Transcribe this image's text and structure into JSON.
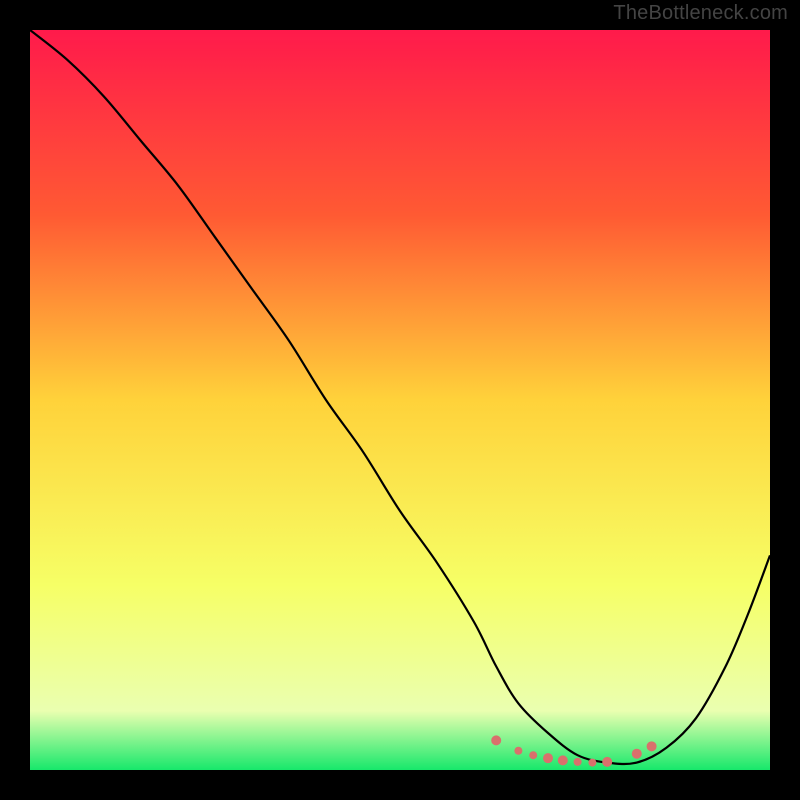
{
  "attribution": "TheBottleneck.com",
  "chart_data": {
    "type": "line",
    "title": "",
    "xlabel": "",
    "ylabel": "",
    "xlim": [
      0,
      100
    ],
    "ylim": [
      0,
      100
    ],
    "gradient_stops": [
      {
        "offset": 0,
        "color": "#ff1a4b"
      },
      {
        "offset": 25,
        "color": "#ff5a33"
      },
      {
        "offset": 50,
        "color": "#ffd23a"
      },
      {
        "offset": 75,
        "color": "#f6ff66"
      },
      {
        "offset": 92,
        "color": "#eaffb0"
      },
      {
        "offset": 100,
        "color": "#17e86b"
      }
    ],
    "series": [
      {
        "name": "bottleneck-curve",
        "x": [
          0,
          5,
          10,
          15,
          20,
          25,
          30,
          35,
          40,
          45,
          50,
          55,
          60,
          63,
          66,
          70,
          74,
          78,
          82,
          86,
          90,
          94,
          97,
          100
        ],
        "y": [
          100,
          96,
          91,
          85,
          79,
          72,
          65,
          58,
          50,
          43,
          35,
          28,
          20,
          14,
          9,
          5,
          2,
          1,
          1,
          3,
          7,
          14,
          21,
          29
        ]
      }
    ],
    "markers": {
      "name": "highlight-dots",
      "color": "#d9706c",
      "radius_pattern": [
        5,
        4,
        4,
        5,
        5,
        4,
        4,
        5,
        5,
        5
      ],
      "x": [
        63,
        66,
        68,
        70,
        72,
        74,
        76,
        78,
        82,
        84
      ],
      "y": [
        4.0,
        2.6,
        2.0,
        1.6,
        1.3,
        1.1,
        1.0,
        1.1,
        2.2,
        3.2
      ]
    }
  }
}
